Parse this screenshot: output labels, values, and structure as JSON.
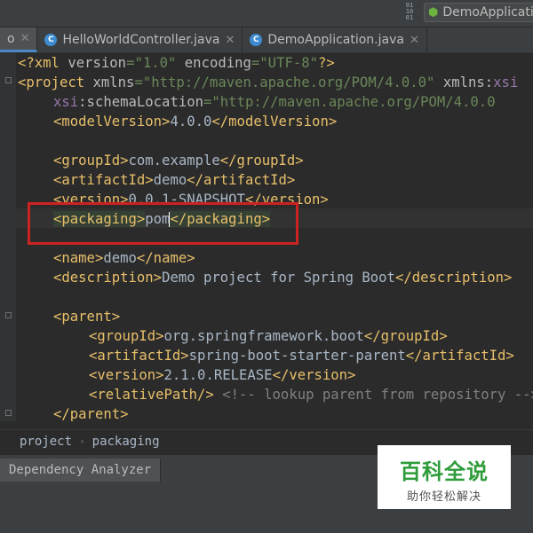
{
  "toolbar": {
    "binary_icon": "01\n10\n01",
    "run_config_label": "DemoApplication",
    "run_config_icon": "spring-boot-icon"
  },
  "tabs": [
    {
      "label": "o",
      "active": true
    },
    {
      "label": "HelloWorldController.java",
      "icon": "class-c-icon"
    },
    {
      "label": "DemoApplication.java",
      "icon": "class-c-icon"
    }
  ],
  "editor": {
    "lines": [
      "<?xml version=\"1.0\" encoding=\"UTF-8\"?>",
      "<project xmlns=\"http://maven.apache.org/POM/4.0.0\" xmlns:xsi",
      "xsi:schemaLocation=\"http://maven.apache.org/POM/4.0.0",
      "<modelVersion>4.0.0</modelVersion>",
      "",
      "<groupId>com.example</groupId>",
      "<artifactId>demo</artifactId>",
      "<version>0.0.1-SNAPSHOT</version>",
      "<packaging>pom</packaging>",
      "",
      "<name>demo</name>",
      "<description>Demo project for Spring Boot</description>",
      "",
      "<parent>",
      "<groupId>org.springframework.boot</groupId>",
      "<artifactId>spring-boot-starter-parent</artifactId>",
      "<version>2.1.0.RELEASE</version>",
      "<relativePath/> <!-- lookup parent from repository -->",
      "</parent>"
    ]
  },
  "breadcrumb": {
    "items": [
      "project",
      "packaging"
    ]
  },
  "bottom": {
    "tab_label": "Dependency Analyzer"
  },
  "watermark": {
    "title": "百科全说",
    "subtitle": "助你轻松解决"
  },
  "colors": {
    "tag": "#e8bf6a",
    "string": "#6a8759",
    "text": "#a9b7c6",
    "highlight_box": "#cc2222",
    "active_tab_underline": "#4a88c7"
  }
}
